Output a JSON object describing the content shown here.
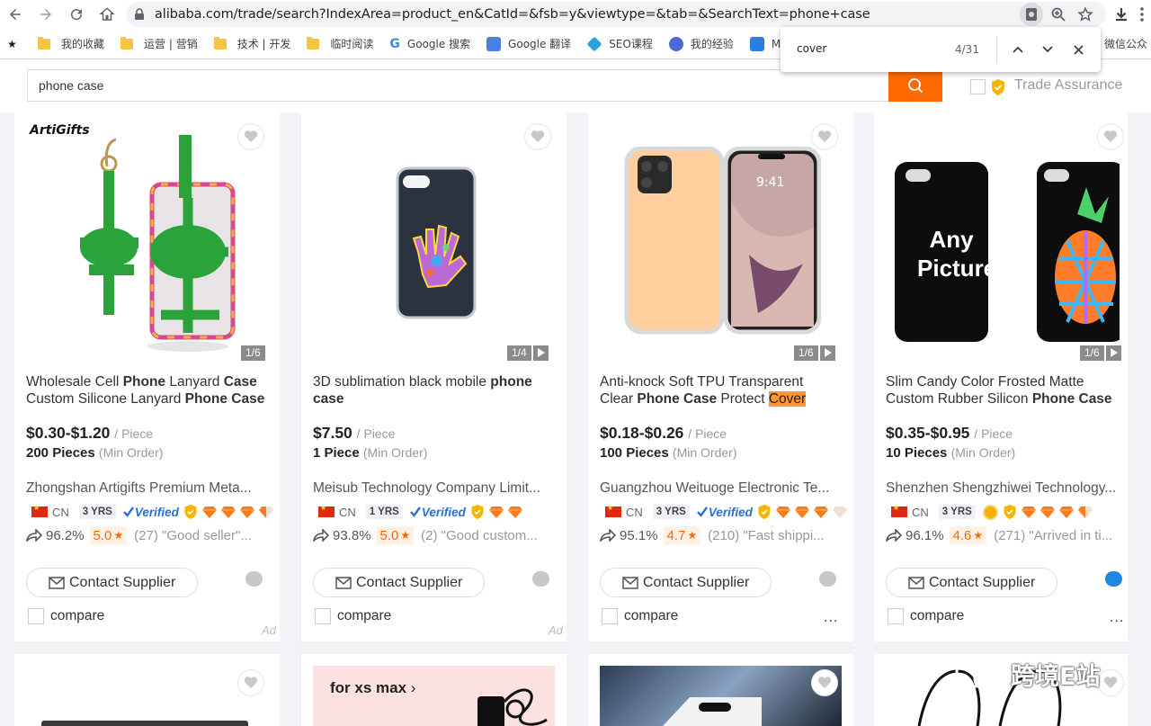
{
  "browser": {
    "url": "alibaba.com/trade/search?IndexArea=product_en&CatId=&fsb=y&viewtype=&tab=&SearchText=phone+case",
    "bookmarks": [
      "我的收藏",
      "运营 | 营销",
      "技术 | 开发",
      "临时阅读",
      "Google 搜索",
      "Google 翻译",
      "SEO课程",
      "我的经验",
      "M",
      "微信公众"
    ]
  },
  "find_bar": {
    "query": "cover",
    "count": "4/31"
  },
  "search": {
    "query": "phone case",
    "trade_assurance_label": "Trade Assurance",
    "accent": "#ff6a00"
  },
  "products": [
    {
      "brand": "ArtiGifts",
      "counter": "1/6",
      "title_parts": [
        "Wholesale Cell ",
        "Phone",
        " Lanyard ",
        "Case",
        " Custom Silicone Lanyard ",
        "Phone Case"
      ],
      "price": "$0.30-$1.20",
      "unit": "/ Piece",
      "moq": "200 Pieces",
      "moq_note": "(Min Order)",
      "company": "Zhongshan Artigifts Premium Meta...",
      "country": "CN",
      "years": "3 YRS",
      "verified": "Verified",
      "response_rate": "96.2%",
      "score": "5.0",
      "reviews": "(27) \"Good seller\"...",
      "contact": "Contact Supplier",
      "compare": "compare",
      "ad": "Ad"
    },
    {
      "counter": "1/4",
      "title_parts": [
        "3D sublimation black mobile ",
        "phone",
        " ",
        "case"
      ],
      "price": "$7.50",
      "unit": "/ Piece",
      "moq": "1 Piece",
      "moq_note": "(Min Order)",
      "company": "Meisub Technology Company Limit...",
      "country": "CN",
      "years": "1 YRS",
      "verified": "Verified",
      "response_rate": "93.8%",
      "score": "5.0",
      "reviews": "(2) \"Good custom...",
      "contact": "Contact Supplier",
      "compare": "compare",
      "ad": "Ad"
    },
    {
      "counter": "1/6",
      "title_line1": "Anti-knock Soft TPU Transparent",
      "title_line2_a": "Clear ",
      "title_line2_b": "Phone Case",
      "title_line2_c": " Protect ",
      "title_line2_d": "Cover",
      "price": "$0.18-$0.26",
      "unit": "/ Piece",
      "moq": "100 Pieces",
      "moq_note": "(Min Order)",
      "company": "Guangzhou Weituoge Electronic Te...",
      "country": "CN",
      "years": "3 YRS",
      "verified": "Verified",
      "response_rate": "95.1%",
      "score": "4.7",
      "reviews": "(210) \"Fast shippi...",
      "contact": "Contact Supplier",
      "compare": "compare",
      "more": "..."
    },
    {
      "counter": "1/6",
      "image_text_1": "Any",
      "image_text_2": "Picture",
      "title_line1": "Slim Candy Color Frosted Matte",
      "title_line2_a": "Custom Rubber Silicon ",
      "title_line2_b": "Phone Case",
      "price": "$0.35-$0.95",
      "unit": "/ Piece",
      "moq": "10 Pieces",
      "moq_note": "(Min Order)",
      "company": "Shenzhen Shengzhiwei Technology...",
      "country": "CN",
      "years": "3 YRS",
      "response_rate": "96.1%",
      "score": "4.6",
      "reviews": "(271) \"Arrived in ti...",
      "contact": "Contact Supplier",
      "compare": "compare",
      "more": "..."
    }
  ],
  "second_row": {
    "banner_text": "for xs max",
    "watermark": "跨境E站"
  }
}
